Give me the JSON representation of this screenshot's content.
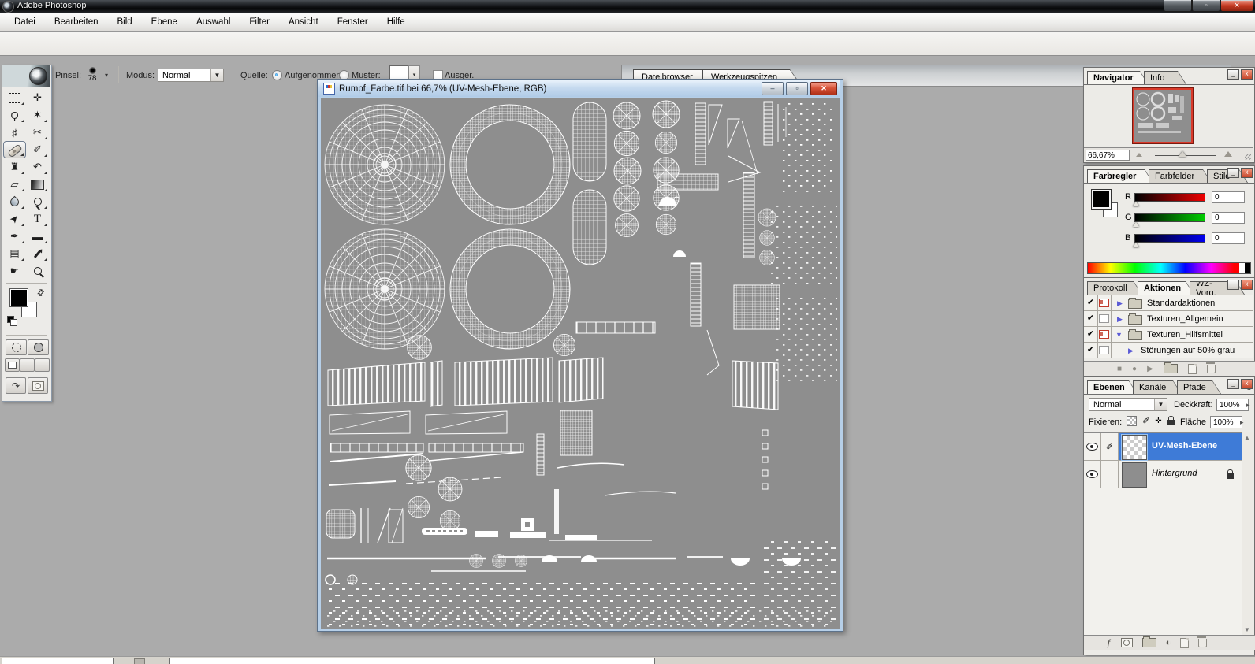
{
  "app": {
    "title": "Adobe Photoshop"
  },
  "menu": {
    "items": [
      "Datei",
      "Bearbeiten",
      "Bild",
      "Ebene",
      "Auswahl",
      "Filter",
      "Ansicht",
      "Fenster",
      "Hilfe"
    ]
  },
  "options": {
    "brush_label": "Pinsel:",
    "brush_size": "78",
    "mode_label": "Modus:",
    "mode_value": "Normal",
    "source_label": "Quelle:",
    "source_sampled": "Aufgenommen",
    "source_pattern": "Muster:",
    "aligned_label": "Ausger.",
    "well_tabs": [
      "Dateibrowser",
      "Werkzeugspitzen"
    ]
  },
  "document": {
    "title": "Rumpf_Farbe.tif bei 66,7% (UV-Mesh-Ebene, RGB)"
  },
  "navigator": {
    "tabs": [
      "Navigator",
      "Info"
    ],
    "zoom_value": "66,67%"
  },
  "color": {
    "tabs": [
      "Farbregler",
      "Farbfelder",
      "Stile"
    ],
    "channels": [
      {
        "label": "R",
        "value": "0"
      },
      {
        "label": "G",
        "value": "0"
      },
      {
        "label": "B",
        "value": "0"
      }
    ]
  },
  "actions": {
    "tabs": [
      "Protokoll",
      "Aktionen",
      "WZ-Vorg."
    ],
    "items": [
      {
        "label": "Standardaktionen"
      },
      {
        "label": "Texturen_Allgemein"
      },
      {
        "label": "Texturen_Hilfsmittel"
      },
      {
        "label": "Störungen auf 50% grau"
      }
    ]
  },
  "layers": {
    "tabs": [
      "Ebenen",
      "Kanäle",
      "Pfade"
    ],
    "blend_mode": "Normal",
    "opacity_label": "Deckkraft:",
    "opacity_value": "100%",
    "lock_label": "Fixieren:",
    "fill_label": "Fläche",
    "fill_value": "100%",
    "items": [
      {
        "name": "UV-Mesh-Ebene"
      },
      {
        "name": "Hintergrund"
      }
    ]
  },
  "tools": {
    "glyphs": [
      "",
      "✛",
      "Ϙ",
      "✶",
      "♯",
      "✂",
      "",
      "✐",
      "♜",
      "↶",
      "▱",
      "",
      "",
      "",
      "➤",
      "T",
      "✒",
      "▬",
      "▤",
      "",
      "☛",
      ""
    ]
  },
  "ui": {
    "chevron": "»",
    "check": "✔",
    "expand": "▶",
    "collapse": "▼",
    "spinner": "▸",
    "dropdown": "▼",
    "up": "▲",
    "down": "▼",
    "stop": "■",
    "record": "●",
    "play": "▶",
    "fx": "ƒ",
    "adjust": "◐",
    "swap": "⇄",
    "ir_arrow": "↷",
    "min_glyph": "–",
    "max_glyph": "▫",
    "close_glyph": "✕"
  },
  "colors": {
    "selection_blue": "#3e7bd7",
    "canvas_gray": "#8e8e8e",
    "workspace_gray": "#ababab",
    "close_red": "#c0361c",
    "navigator_frame_red": "#d93a2a"
  }
}
